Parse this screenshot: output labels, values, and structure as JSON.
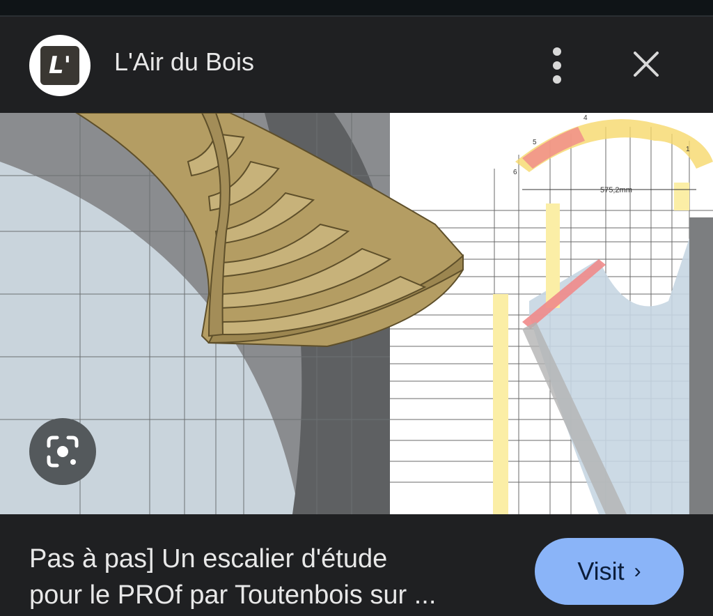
{
  "header": {
    "logo_text": "L'",
    "site_name": "L'Air du Bois",
    "menu_icon": "more-vert-icon",
    "close_icon": "close-icon"
  },
  "image": {
    "dimension_label": "575,2mm",
    "step_numbers": [
      "1",
      "4",
      "5",
      "6"
    ]
  },
  "lens": {
    "icon": "google-lens-icon"
  },
  "footer": {
    "caption_line1": "Pas à pas] Un escalier d'étude",
    "caption_line2": "pour le PROf par Toutenbois sur ...",
    "visit_label": "Visit",
    "visit_chevron": "›"
  },
  "colors": {
    "background": "#1f2022",
    "visit_button": "#8ab4f8",
    "wood": "#b49d63"
  }
}
